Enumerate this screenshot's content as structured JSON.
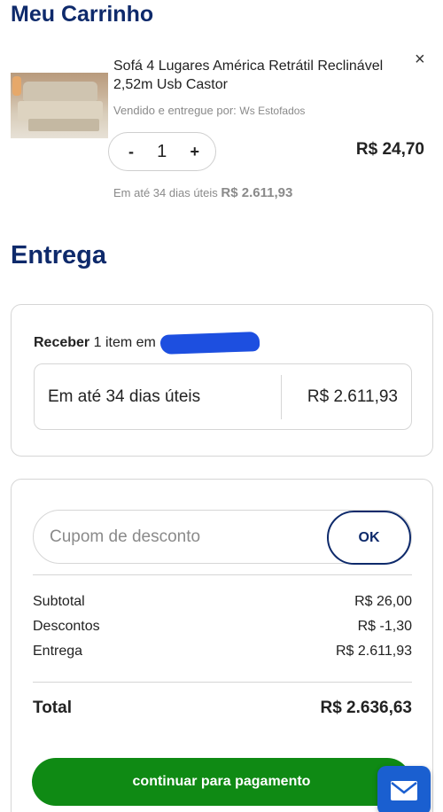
{
  "cart": {
    "title": "Meu Carrinho",
    "item": {
      "name": "Sofá 4 Lugares América Retrátil Reclinável 2,52m Usb Castor",
      "seller_prefix": "Vendido e entregue por:",
      "seller_name": "Ws Estofados",
      "quantity": "1",
      "minus_label": "-",
      "plus_label": "+",
      "price": "R$ 24,70",
      "installment_prefix": "Em até 34 dias úteis",
      "installment_value": "R$ 2.611,93",
      "remove_icon": "×"
    }
  },
  "delivery": {
    "title": "Entrega",
    "receive_label": "Receber",
    "receive_text": "1 item em",
    "option_label": "Em até 34 dias úteis",
    "option_price": "R$ 2.611,93"
  },
  "summary": {
    "coupon_placeholder": "Cupom de desconto",
    "ok_label": "OK",
    "rows": [
      {
        "label": "Subtotal",
        "value": "R$ 26,00"
      },
      {
        "label": "Descontos",
        "value": "R$ -1,30"
      },
      {
        "label": "Entrega",
        "value": "R$ 2.611,93"
      }
    ],
    "total_label": "Total",
    "total_value": "R$ 2.636,63",
    "pay_label": "continuar para pagamento"
  },
  "colors": {
    "brand_navy": "#0e2a6b",
    "pay_green": "#0f8a14",
    "chat_blue": "#1a5fd0",
    "redaction_blue": "#1d4fe0"
  },
  "icons": {
    "close": "close-icon",
    "chat": "envelope-icon"
  }
}
